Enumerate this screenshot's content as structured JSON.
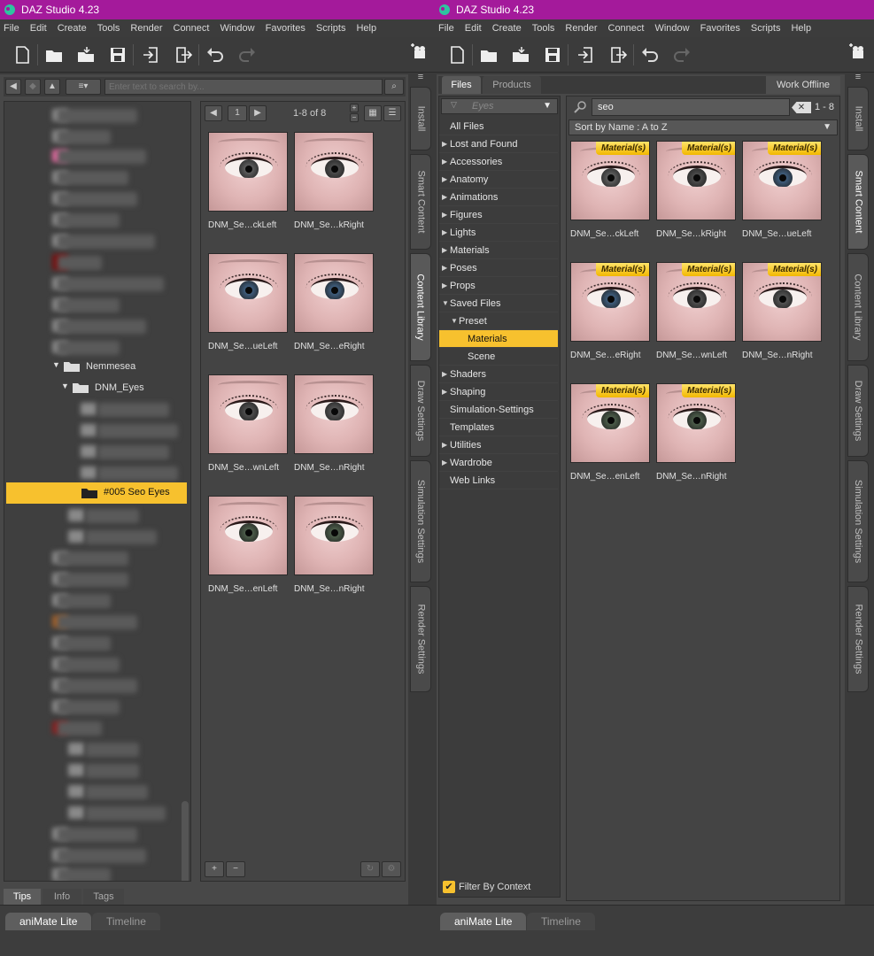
{
  "app": {
    "title": "DAZ Studio 4.23"
  },
  "menu": [
    "File",
    "Edit",
    "Create",
    "Tools",
    "Render",
    "Connect",
    "Window",
    "Favorites",
    "Scripts",
    "Help"
  ],
  "side_tabs": [
    "Install",
    "Smart Content",
    "Content Library",
    "Draw Settings",
    "Simulation Settings",
    "Render Settings"
  ],
  "bottom_tabs": [
    "aniMate Lite",
    "Timeline"
  ],
  "left": {
    "search_placeholder": "Enter text to search by...",
    "page_number": "1",
    "page_range": "1-8 of 8",
    "tree": {
      "folder1": "Nemmesea",
      "folder2": "DNM_Eyes",
      "selected": "#005 Seo Eyes"
    },
    "thumbs": [
      "DNM_Se…ckLeft",
      "DNM_Se…kRight",
      "DNM_Se…ueLeft",
      "DNM_Se…eRight",
      "DNM_Se…wnLeft",
      "DNM_Se…nRight",
      "DNM_Se…enLeft",
      "DNM_Se…nRight"
    ],
    "footer_tabs": [
      "Tips",
      "Info",
      "Tags"
    ],
    "add_label": "+",
    "remove_label": "−"
  },
  "right": {
    "top_tabs": [
      "Files",
      "Products"
    ],
    "work_offline": "Work Offline",
    "filter_placeholder": "Eyes",
    "search_value": "seo",
    "result_range": "1 - 8",
    "sort_label": "Sort by Name : A to Z",
    "categories": [
      {
        "label": "All Files",
        "arrow": ""
      },
      {
        "label": "Lost and Found",
        "arrow": "▶"
      },
      {
        "label": "Accessories",
        "arrow": "▶"
      },
      {
        "label": "Anatomy",
        "arrow": "▶"
      },
      {
        "label": "Animations",
        "arrow": "▶"
      },
      {
        "label": "Figures",
        "arrow": "▶"
      },
      {
        "label": "Lights",
        "arrow": "▶"
      },
      {
        "label": "Materials",
        "arrow": "▶"
      },
      {
        "label": "Poses",
        "arrow": "▶"
      },
      {
        "label": "Props",
        "arrow": "▶"
      },
      {
        "label": "Saved Files",
        "arrow": "▼"
      },
      {
        "label": "Preset",
        "arrow": "▼"
      },
      {
        "label": "Materials",
        "arrow": ""
      },
      {
        "label": "Scene",
        "arrow": ""
      },
      {
        "label": "Shaders",
        "arrow": "▶"
      },
      {
        "label": "Shaping",
        "arrow": "▶"
      },
      {
        "label": "Simulation-Settings",
        "arrow": ""
      },
      {
        "label": "Templates",
        "arrow": ""
      },
      {
        "label": "Utilities",
        "arrow": "▶"
      },
      {
        "label": "Wardrobe",
        "arrow": "▶"
      },
      {
        "label": "Web Links",
        "arrow": ""
      }
    ],
    "filter_by_context": "Filter By Context",
    "badge": "Material(s)",
    "thumbs": [
      "DNM_Se…ckLeft",
      "DNM_Se…kRight",
      "DNM_Se…ueLeft",
      "DNM_Se…eRight",
      "DNM_Se…wnLeft",
      "DNM_Se…nRight",
      "DNM_Se…enLeft",
      "DNM_Se…nRight"
    ]
  },
  "colors": {
    "titlebar": "#a41a9b",
    "highlight": "#f7c12e"
  }
}
